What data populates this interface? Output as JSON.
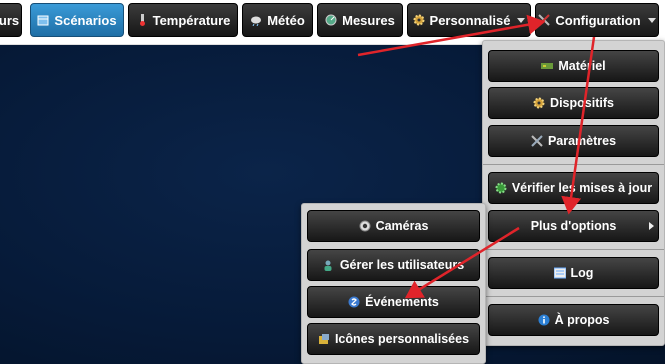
{
  "navbar": {
    "items": [
      {
        "label": "urs"
      },
      {
        "label": "Scénarios"
      },
      {
        "label": "Température"
      },
      {
        "label": "Météo"
      },
      {
        "label": "Mesures"
      },
      {
        "label": "Personnalisé"
      },
      {
        "label": "Configuration"
      }
    ]
  },
  "config_menu": {
    "items": [
      {
        "label": "Matériel"
      },
      {
        "label": "Dispositifs"
      },
      {
        "label": "Paramètres"
      },
      {
        "label": "Vérifier les mises à jour"
      },
      {
        "label": "Plus d'options"
      },
      {
        "label": "Log"
      },
      {
        "label": "À propos"
      }
    ]
  },
  "options_submenu": {
    "items": [
      {
        "label": "Caméras"
      },
      {
        "label": "Gérer les utilisateurs"
      },
      {
        "label": "Événements"
      },
      {
        "label": "Icônes personnalisées"
      }
    ]
  },
  "colors": {
    "active_tab": "#2f86c4",
    "annotation_arrow": "#e0242a",
    "background": "#061a38"
  }
}
